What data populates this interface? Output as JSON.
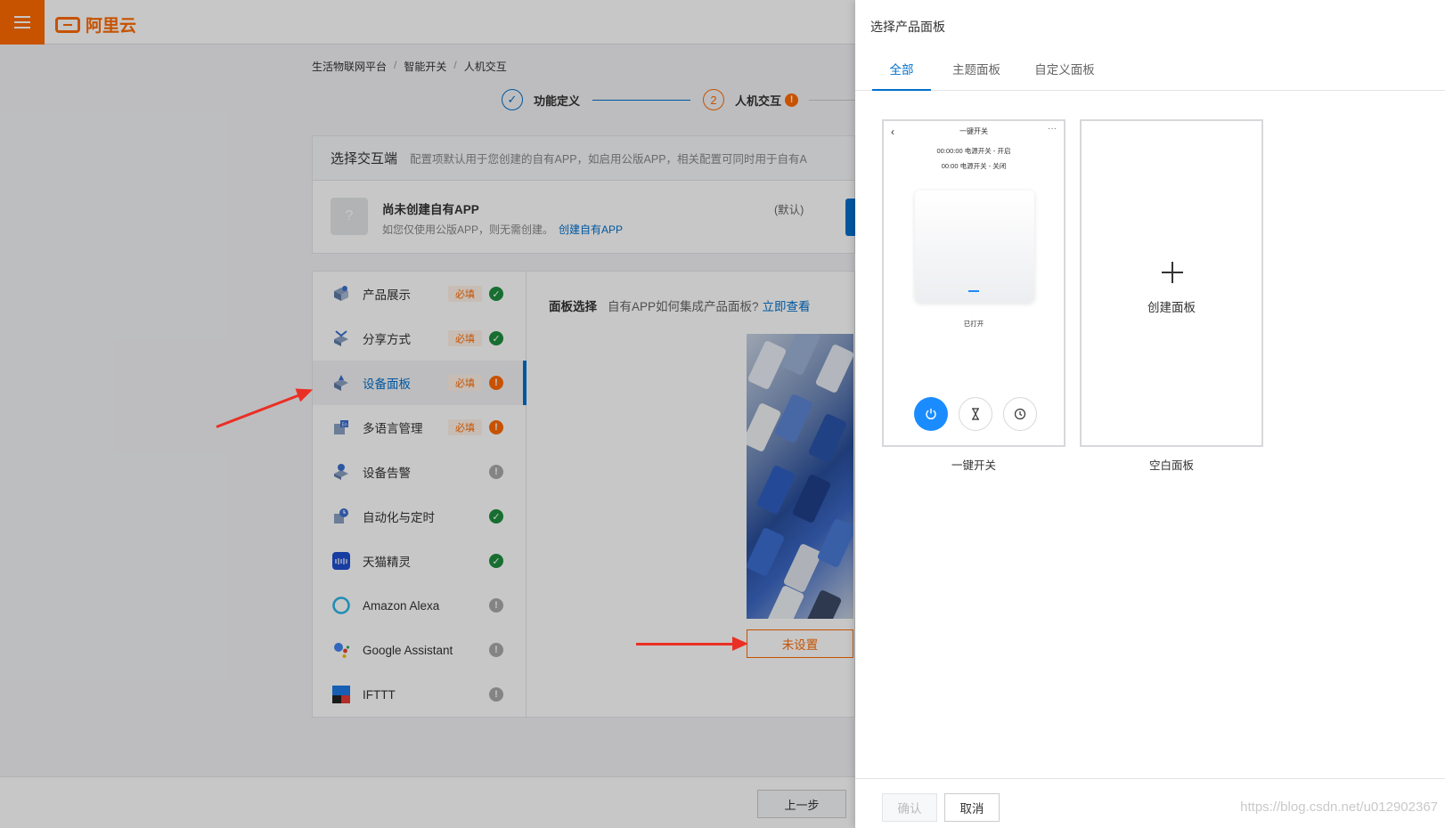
{
  "header": {
    "logo_text": "阿里云"
  },
  "breadcrumb": [
    "生活物联网平台",
    "智能开关",
    "人机交互"
  ],
  "steps": [
    {
      "number": "✓",
      "label": "功能定义"
    },
    {
      "number": "2",
      "label": "人机交互",
      "warn": "!"
    }
  ],
  "terminal": {
    "title": "选择交互端",
    "description": "配置项默认用于您创建的自有APP，如启用公版APP，相关配置可同时用于自有A",
    "app_avatar": "?",
    "app_name": "尚未创建自有APP",
    "app_note": "如您仅使用公版APP，则无需创建。",
    "create_link": "创建自有APP",
    "default_tag": "(默认)"
  },
  "nav": {
    "required_tag": "必填",
    "items": [
      {
        "label": "产品展示",
        "required": true,
        "status": "ok"
      },
      {
        "label": "分享方式",
        "required": true,
        "status": "ok"
      },
      {
        "label": "设备面板",
        "required": true,
        "status": "warn",
        "selected": true
      },
      {
        "label": "多语言管理",
        "required": true,
        "status": "warn"
      },
      {
        "label": "设备告警",
        "required": false,
        "status": "none"
      },
      {
        "label": "自动化与定时",
        "required": false,
        "status": "ok"
      },
      {
        "label": "天猫精灵",
        "required": false,
        "status": "ok"
      },
      {
        "label": "Amazon Alexa",
        "required": false,
        "status": "none"
      },
      {
        "label": "Google Assistant",
        "required": false,
        "status": "none"
      },
      {
        "label": "IFTTT",
        "required": false,
        "status": "none"
      }
    ]
  },
  "panel": {
    "label": "面板选择",
    "question": "自有APP如何集成产品面板?",
    "link": "立即查看",
    "not_set_button": "未设置"
  },
  "footer": {
    "prev_button": "上一步"
  },
  "drawer": {
    "title": "选择产品面板",
    "tabs": [
      {
        "label": "全部",
        "active": true
      },
      {
        "label": "主题面板",
        "active": false
      },
      {
        "label": "自定义面板",
        "active": false
      }
    ],
    "panels": [
      {
        "caption": "一键开关",
        "preview_title": "一键开关",
        "line1": "00:00:00 电源开关 - 开启",
        "line2": "00:00 电源开关 - 关闭",
        "state": "已打开"
      },
      {
        "caption": "空白面板",
        "create_label": "创建面板"
      }
    ],
    "confirm_button": "确认",
    "cancel_button": "取消"
  },
  "watermark": "https://blog.csdn.net/u012902367",
  "colors": {
    "brand_orange": "#ff6a00",
    "primary_blue": "#0070cc",
    "success_green": "#1e8e3e",
    "arrow_red": "#ea2f24"
  }
}
